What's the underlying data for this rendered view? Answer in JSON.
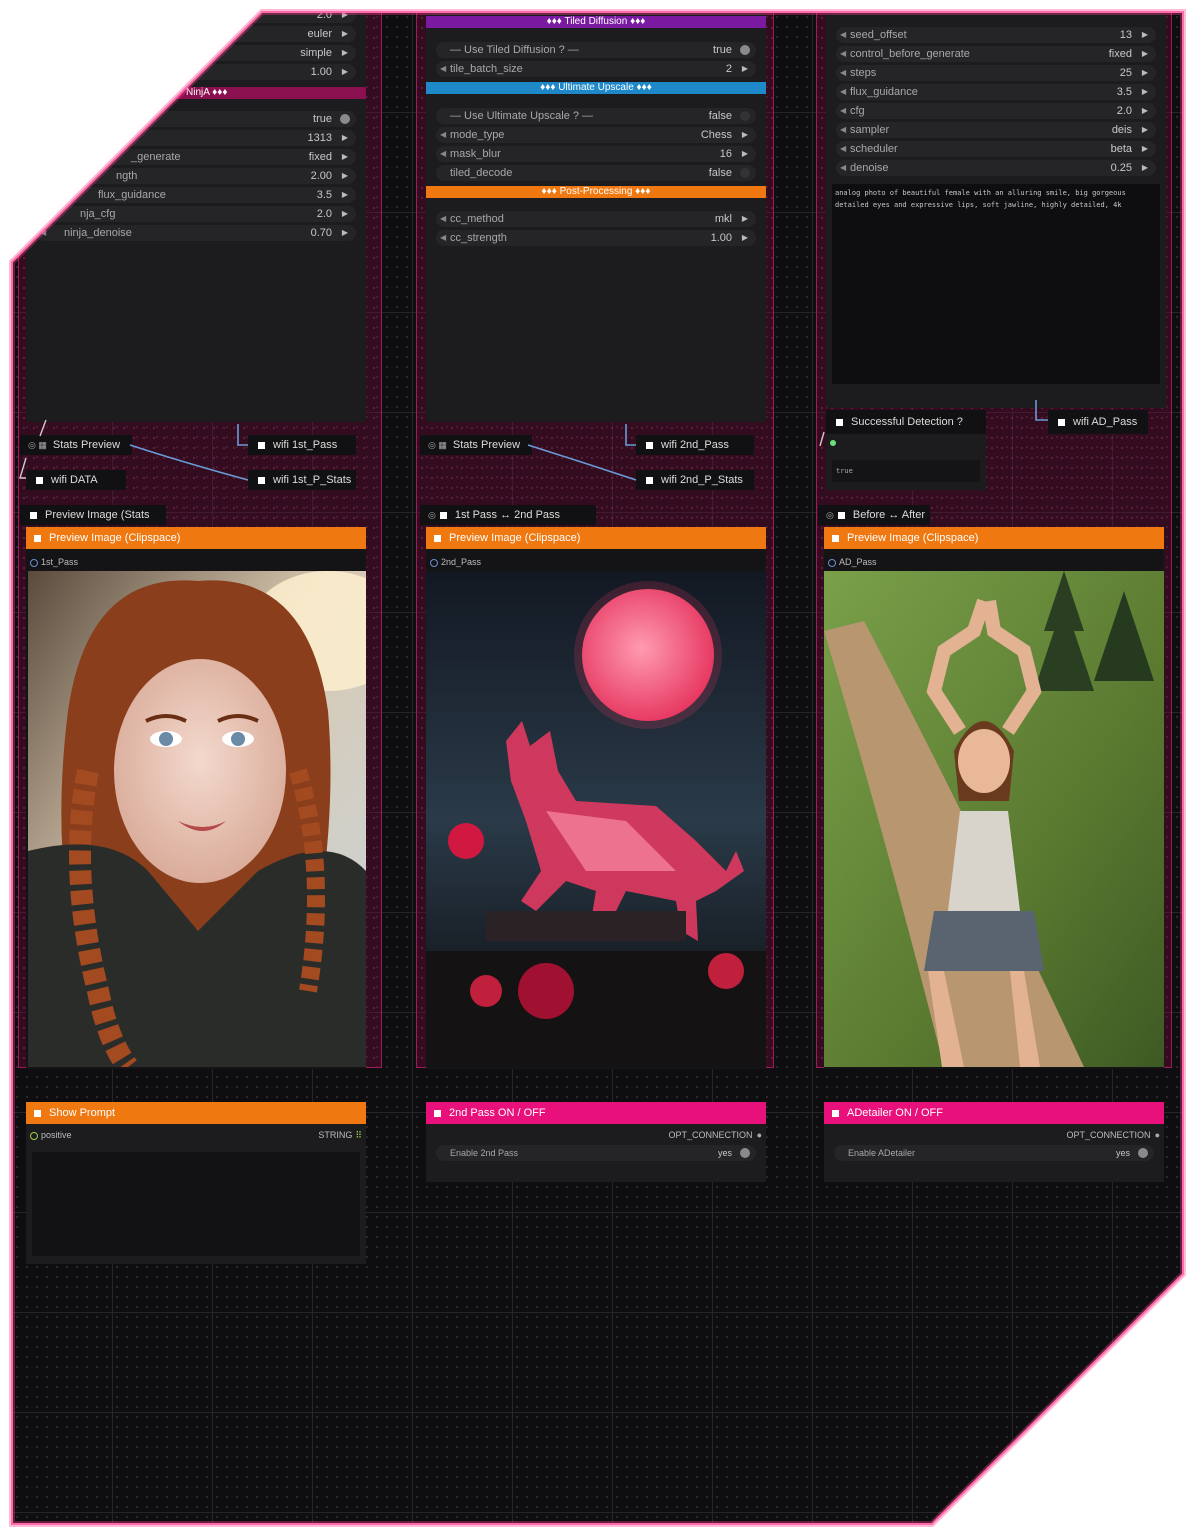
{
  "panel_left": {
    "top_values": [
      "2.0",
      "euler",
      "simple",
      "1.00"
    ],
    "ninja_bar": "NinjA ♦♦♦",
    "rows": [
      {
        "label": "",
        "value": "true"
      },
      {
        "label": "",
        "value": "1313"
      },
      {
        "label": "_generate",
        "value": "fixed"
      },
      {
        "label": "ngth",
        "value": "2.00"
      },
      {
        "label": "flux_guidance",
        "value": "3.5"
      },
      {
        "label": "nja_cfg",
        "value": "2.0"
      },
      {
        "label": "ninja_denoise",
        "value": "0.70"
      }
    ],
    "stats_preview": "Stats Preview",
    "wifi_data": "wifi DATA",
    "wifi_pass": "wifi 1st_Pass",
    "wifi_stats": "wifi 1st_P_Stats",
    "preview_stats": "Preview Image (Stats",
    "clipspace": "Preview Image (Clipspace)",
    "image_slot": "1st_Pass"
  },
  "panel_mid": {
    "tiled_bar": "♦♦♦ Tiled Diffusion ♦♦♦",
    "use_tiled": {
      "label": "— Use Tiled Diffusion ? —",
      "value": "true"
    },
    "tile_batch": {
      "label": "tile_batch_size",
      "value": "2"
    },
    "upscale_bar": "♦♦♦ Ultimate Upscale ♦♦♦",
    "use_upscale": {
      "label": "— Use Ultimate Upscale ? —",
      "value": "false"
    },
    "mode_type": {
      "label": "mode_type",
      "value": "Chess"
    },
    "mask_blur": {
      "label": "mask_blur",
      "value": "16"
    },
    "tiled_decode": {
      "label": "tiled_decode",
      "value": "false"
    },
    "post_bar": "♦♦♦ Post-Processing ♦♦♦",
    "cc_method": {
      "label": "cc_method",
      "value": "mkl"
    },
    "cc_strength": {
      "label": "cc_strength",
      "value": "1.00"
    },
    "stats_preview": "Stats Preview",
    "wifi_pass": "wifi 2nd_Pass",
    "wifi_stats": "wifi 2nd_P_Stats",
    "compare": "1st Pass ↔ 2nd Pass",
    "clipspace": "Preview Image (Clipspace)",
    "image_slot": "2nd_Pass"
  },
  "panel_right": {
    "rows": [
      {
        "label": "seed_offset",
        "value": "13"
      },
      {
        "label": "control_before_generate",
        "value": "fixed"
      },
      {
        "label": "steps",
        "value": "25"
      },
      {
        "label": "flux_guidance",
        "value": "3.5"
      },
      {
        "label": "cfg",
        "value": "2.0"
      },
      {
        "label": "sampler",
        "value": "deis"
      },
      {
        "label": "scheduler",
        "value": "beta"
      },
      {
        "label": "denoise",
        "value": "0.25"
      }
    ],
    "prompt_text": "analog photo of beautiful female with an alluring smile, big gorgeous detailed eyes and expressive lips, soft jawline, highly detailed, 4k",
    "detection": "Successful Detection ?",
    "detection_value": "true",
    "wifi_pass": "wifi AD_Pass",
    "compare": "Before ↔ After",
    "clipspace": "Preview Image (Clipspace)",
    "image_slot": "AD_Pass"
  },
  "bottom": {
    "show_prompt": "Show Prompt",
    "positive": "positive",
    "string": "STRING",
    "pass2_title": "2nd Pass  ON / OFF",
    "opt_connection": "OPT_CONNECTION",
    "enable_2nd": "Enable 2nd Pass",
    "yes": "yes",
    "adetailer_title": "ADetailer  ON / OFF",
    "enable_ad": "Enable ADetailer"
  },
  "colors": {
    "group": "#a0195a",
    "orange": "#f07810",
    "pink": "#e8107a",
    "purple": "#7a1aa0",
    "blue": "#1e88c8",
    "link": "#6a9ad8",
    "edge_glow": "#ff3b8d"
  },
  "icons": [
    "triangle-left-icon",
    "triangle-right-icon",
    "toggle-icon",
    "square-marker-icon",
    "slot-dot-icon",
    "grid-icon"
  ]
}
